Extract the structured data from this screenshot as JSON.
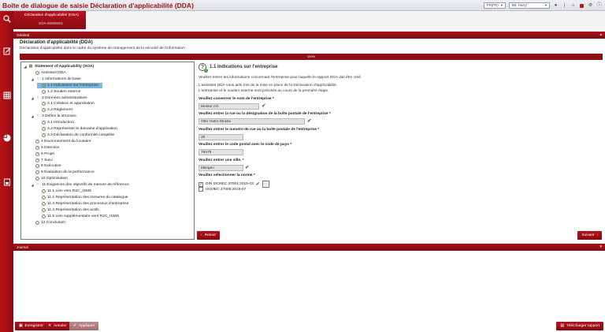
{
  "app_title": "Boîte de dialogue de saisie Déclaration d'applicabilité (DDA)",
  "topbar": {
    "language": "FR(FR)",
    "user": "Bit, Harry"
  },
  "tab": {
    "title": "Déclaration d'applicabilité (DDA)",
    "subtitle": "SOA-00000001"
  },
  "sections": {
    "general": "Général",
    "journal": "Journal"
  },
  "header": {
    "title": "Déclaration d'applicabilité (DDA)",
    "subtitle": "Déclaration d'applicabilité dans le cadre du système de management de la sécurité de l'information"
  },
  "progress": {
    "label": "100%",
    "value": 100
  },
  "tree": [
    {
      "label": "Statement of Applicability (SOA)",
      "level": 0,
      "arrow": "◢",
      "icon": "doc-icon",
      "bold": true
    },
    {
      "label": "Assistant DDA",
      "level": 1,
      "arrow": "",
      "icon": "help-icon"
    },
    {
      "label": "1 Informations de base",
      "level": 1,
      "arrow": "◢",
      "icon": "bulb-icon"
    },
    {
      "label": "1.1 Indications sur l'entreprise",
      "level": 2,
      "arrow": "",
      "icon": "help-icon",
      "selected": true
    },
    {
      "label": "1.2 Soutien externe",
      "level": 2,
      "arrow": "",
      "icon": "help-icon"
    },
    {
      "label": "2 Données administratives",
      "level": 1,
      "arrow": "◢",
      "icon": "bulb-icon"
    },
    {
      "label": "2.1 Créateur et approbation",
      "level": 2,
      "arrow": "",
      "icon": "help-icon"
    },
    {
      "label": "2.2 Règlement",
      "level": 2,
      "arrow": "",
      "icon": "help-icon"
    },
    {
      "label": "3 Définir la structure",
      "level": 1,
      "arrow": "◢",
      "icon": "bulb-icon"
    },
    {
      "label": "3.1 Introduction",
      "level": 2,
      "arrow": "",
      "icon": "help-icon"
    },
    {
      "label": "3.2 Représenter le domaine d'application",
      "level": 2,
      "arrow": "",
      "icon": "help-icon"
    },
    {
      "label": "3.3 Déclaration de conformité complète",
      "level": 2,
      "arrow": "",
      "icon": "help-icon"
    },
    {
      "label": "4 Environnement du locataire",
      "level": 1,
      "arrow": "",
      "icon": "help-icon"
    },
    {
      "label": "5 Direction",
      "level": 1,
      "arrow": "",
      "icon": "help-icon"
    },
    {
      "label": "6 Projet",
      "level": 1,
      "arrow": "",
      "icon": "help-icon"
    },
    {
      "label": "7 Suivi",
      "level": 1,
      "arrow": "",
      "icon": "help-icon"
    },
    {
      "label": "8 Exécution",
      "level": 1,
      "arrow": "",
      "icon": "help-icon"
    },
    {
      "label": "9 Évaluation de la performance",
      "level": 1,
      "arrow": "",
      "icon": "help-icon"
    },
    {
      "label": "10 Optimisation",
      "level": 1,
      "arrow": "",
      "icon": "help-icon"
    },
    {
      "label": "11 Exigences des objectifs de mesure de référence",
      "level": 1,
      "arrow": "◢",
      "icon": "bulb-icon"
    },
    {
      "label": "11.1 Lien vers R2C_ISMS",
      "level": 2,
      "arrow": "",
      "icon": "help-icon"
    },
    {
      "label": "11.2 Représentation des mesures du catalogue",
      "level": 2,
      "arrow": "",
      "icon": "help-icon"
    },
    {
      "label": "11.3 Représentation des processus d'entreprise",
      "level": 2,
      "arrow": "",
      "icon": "help-icon"
    },
    {
      "label": "11.4 Représentation des actifs",
      "level": 2,
      "arrow": "",
      "icon": "help-icon"
    },
    {
      "label": "11.5 Lien supplémentaire vers R2C_ISMS",
      "level": 2,
      "arrow": "",
      "icon": "help-icon"
    },
    {
      "label": "12 Conclusion",
      "level": 1,
      "arrow": "",
      "icon": "help-icon"
    }
  ],
  "form": {
    "title": "1.1 Indications sur l'entreprise",
    "intro1": "Veuillez entrer les informations concernant l'entreprise pour laquelle le rapport DDA doit être créé.",
    "intro2": "L'assistant DDA vous aide lors de la mise en place de la Déclaration d'applicabilité.",
    "intro3": "L'entreprise et le soutien externe sont précisés au cours de la première étape.",
    "company_label": "Veuillez conserver le nom de l'entreprise *",
    "company_value": "Muster AG",
    "street_label": "Veuillez entrer la rue ou la désignation de la boîte postale de l'entreprise *",
    "street_value": "Otto-Hahn-Straße",
    "number_label": "Veuillez entrer le numéro de rue ou la boîte postale de l'entreprise *",
    "number_value": "20",
    "postal_label": "Veuillez entrer le code postal avec le code de pays *",
    "postal_value": "78275",
    "city_label": "Veuillez entrer une ville. *",
    "city_value": "Ittlingen",
    "norm_label": "Veuillez sélectionner la norme *",
    "norm_options": [
      {
        "label": "DIN ISO/IEC 27001:2015-03",
        "checked": true
      },
      {
        "label": "ISO/IEC 27005:2018-07",
        "checked": false
      }
    ],
    "back_label": "Retour",
    "next_label": "Suivant"
  },
  "footer": {
    "save": "Enregistrer",
    "cancel": "Annuler",
    "apply": "Appliquer",
    "download": "Télécharger rapport"
  }
}
